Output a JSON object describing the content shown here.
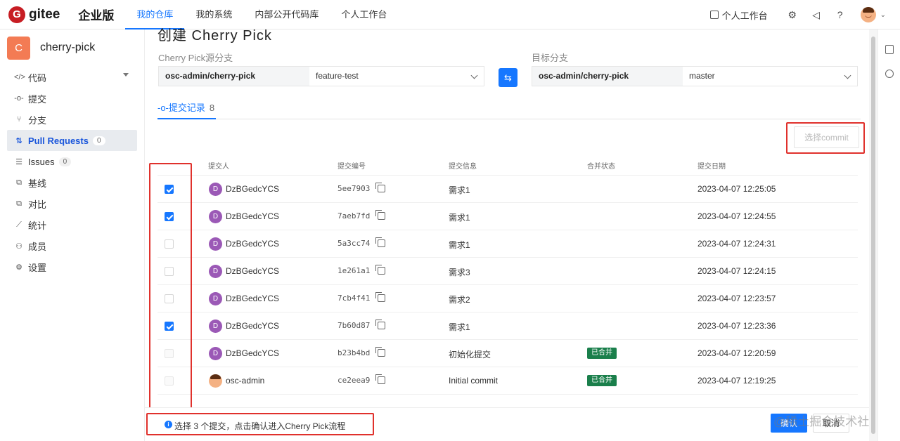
{
  "brand": {
    "logo_letter": "G",
    "name": "gitee",
    "edition": "企业版"
  },
  "nav": [
    {
      "label": "我的仓库",
      "active": true
    },
    {
      "label": "我的系统",
      "active": false
    },
    {
      "label": "内部公开代码库",
      "active": false
    },
    {
      "label": "个人工作台",
      "active": false
    }
  ],
  "topright": {
    "workspace_label": "个人工作台"
  },
  "repo": {
    "badge": "C",
    "name": "cherry-pick"
  },
  "menu": [
    {
      "label": "代码",
      "icon": "code-icon",
      "glyph": "</>"
    },
    {
      "label": "提交",
      "icon": "commit-icon",
      "glyph": "-o-"
    },
    {
      "label": "分支",
      "icon": "branch-icon",
      "glyph": "⑂"
    },
    {
      "label": "Pull Requests",
      "icon": "pull-request-icon",
      "glyph": "⇅",
      "count": "0",
      "active": true
    },
    {
      "label": "Issues",
      "icon": "issues-icon",
      "glyph": "☰",
      "count": "0"
    },
    {
      "label": "基线",
      "icon": "baseline-icon",
      "glyph": "⧉"
    },
    {
      "label": "对比",
      "icon": "compare-icon",
      "glyph": "⧉"
    },
    {
      "label": "统计",
      "icon": "stats-icon",
      "glyph": "⟋"
    },
    {
      "label": "成员",
      "icon": "members-icon",
      "glyph": "⚇"
    },
    {
      "label": "设置",
      "icon": "settings-icon",
      "glyph": "⚙"
    }
  ],
  "page": {
    "title": "创建 Cherry Pick"
  },
  "source": {
    "label": "Cherry Pick源分支",
    "repo": "osc-admin/cherry-pick",
    "branch": "feature-test"
  },
  "target": {
    "label": "目标分支",
    "repo": "osc-admin/cherry-pick",
    "branch": "master"
  },
  "tab": {
    "icon": "commit-icon",
    "label": "提交记录",
    "count": "8"
  },
  "choose_commit_label": "选择commit",
  "columns": {
    "author": "提交人",
    "sha": "提交编号",
    "message": "提交信息",
    "merge_status": "合并状态",
    "date": "提交日期"
  },
  "commits": [
    {
      "checked": true,
      "disabled": false,
      "avatar": "D",
      "author": "DzBGedcYCS",
      "sha": "5ee7903",
      "message": "需求1",
      "merged": "",
      "date": "2023-04-07 12:25:05"
    },
    {
      "checked": true,
      "disabled": false,
      "avatar": "D",
      "author": "DzBGedcYCS",
      "sha": "7aeb7fd",
      "message": "需求1",
      "merged": "",
      "date": "2023-04-07 12:24:55"
    },
    {
      "checked": false,
      "disabled": false,
      "avatar": "D",
      "author": "DzBGedcYCS",
      "sha": "5a3cc74",
      "message": "需求1",
      "merged": "",
      "date": "2023-04-07 12:24:31"
    },
    {
      "checked": false,
      "disabled": false,
      "avatar": "D",
      "author": "DzBGedcYCS",
      "sha": "1e261a1",
      "message": "需求3",
      "merged": "",
      "date": "2023-04-07 12:24:15"
    },
    {
      "checked": false,
      "disabled": false,
      "avatar": "D",
      "author": "DzBGedcYCS",
      "sha": "7cb4f41",
      "message": "需求2",
      "merged": "",
      "date": "2023-04-07 12:23:57"
    },
    {
      "checked": true,
      "disabled": false,
      "avatar": "D",
      "author": "DzBGedcYCS",
      "sha": "7b60d87",
      "message": "需求1",
      "merged": "",
      "date": "2023-04-07 12:23:36"
    },
    {
      "checked": false,
      "disabled": true,
      "avatar": "D",
      "author": "DzBGedcYCS",
      "sha": "b23b4bd",
      "message": "初始化提交",
      "merged": "已合并",
      "date": "2023-04-07 12:20:59"
    },
    {
      "checked": false,
      "disabled": true,
      "avatar": "",
      "author": "osc-admin",
      "sha": "ce2eea9",
      "message": "Initial commit",
      "merged": "已合并",
      "date": "2023-04-07 12:19:25"
    }
  ],
  "footer": {
    "info": "选择 3 个提交，点击确认进入Cherry Pick流程",
    "confirm": "确认",
    "cancel": "取消"
  },
  "watermark": "@稀土掘金技术社区",
  "colors": {
    "accent": "#1677ff",
    "brand": "#c71d23",
    "highlight_box": "#e0312c",
    "merged_badge": "#1a7f4b"
  }
}
